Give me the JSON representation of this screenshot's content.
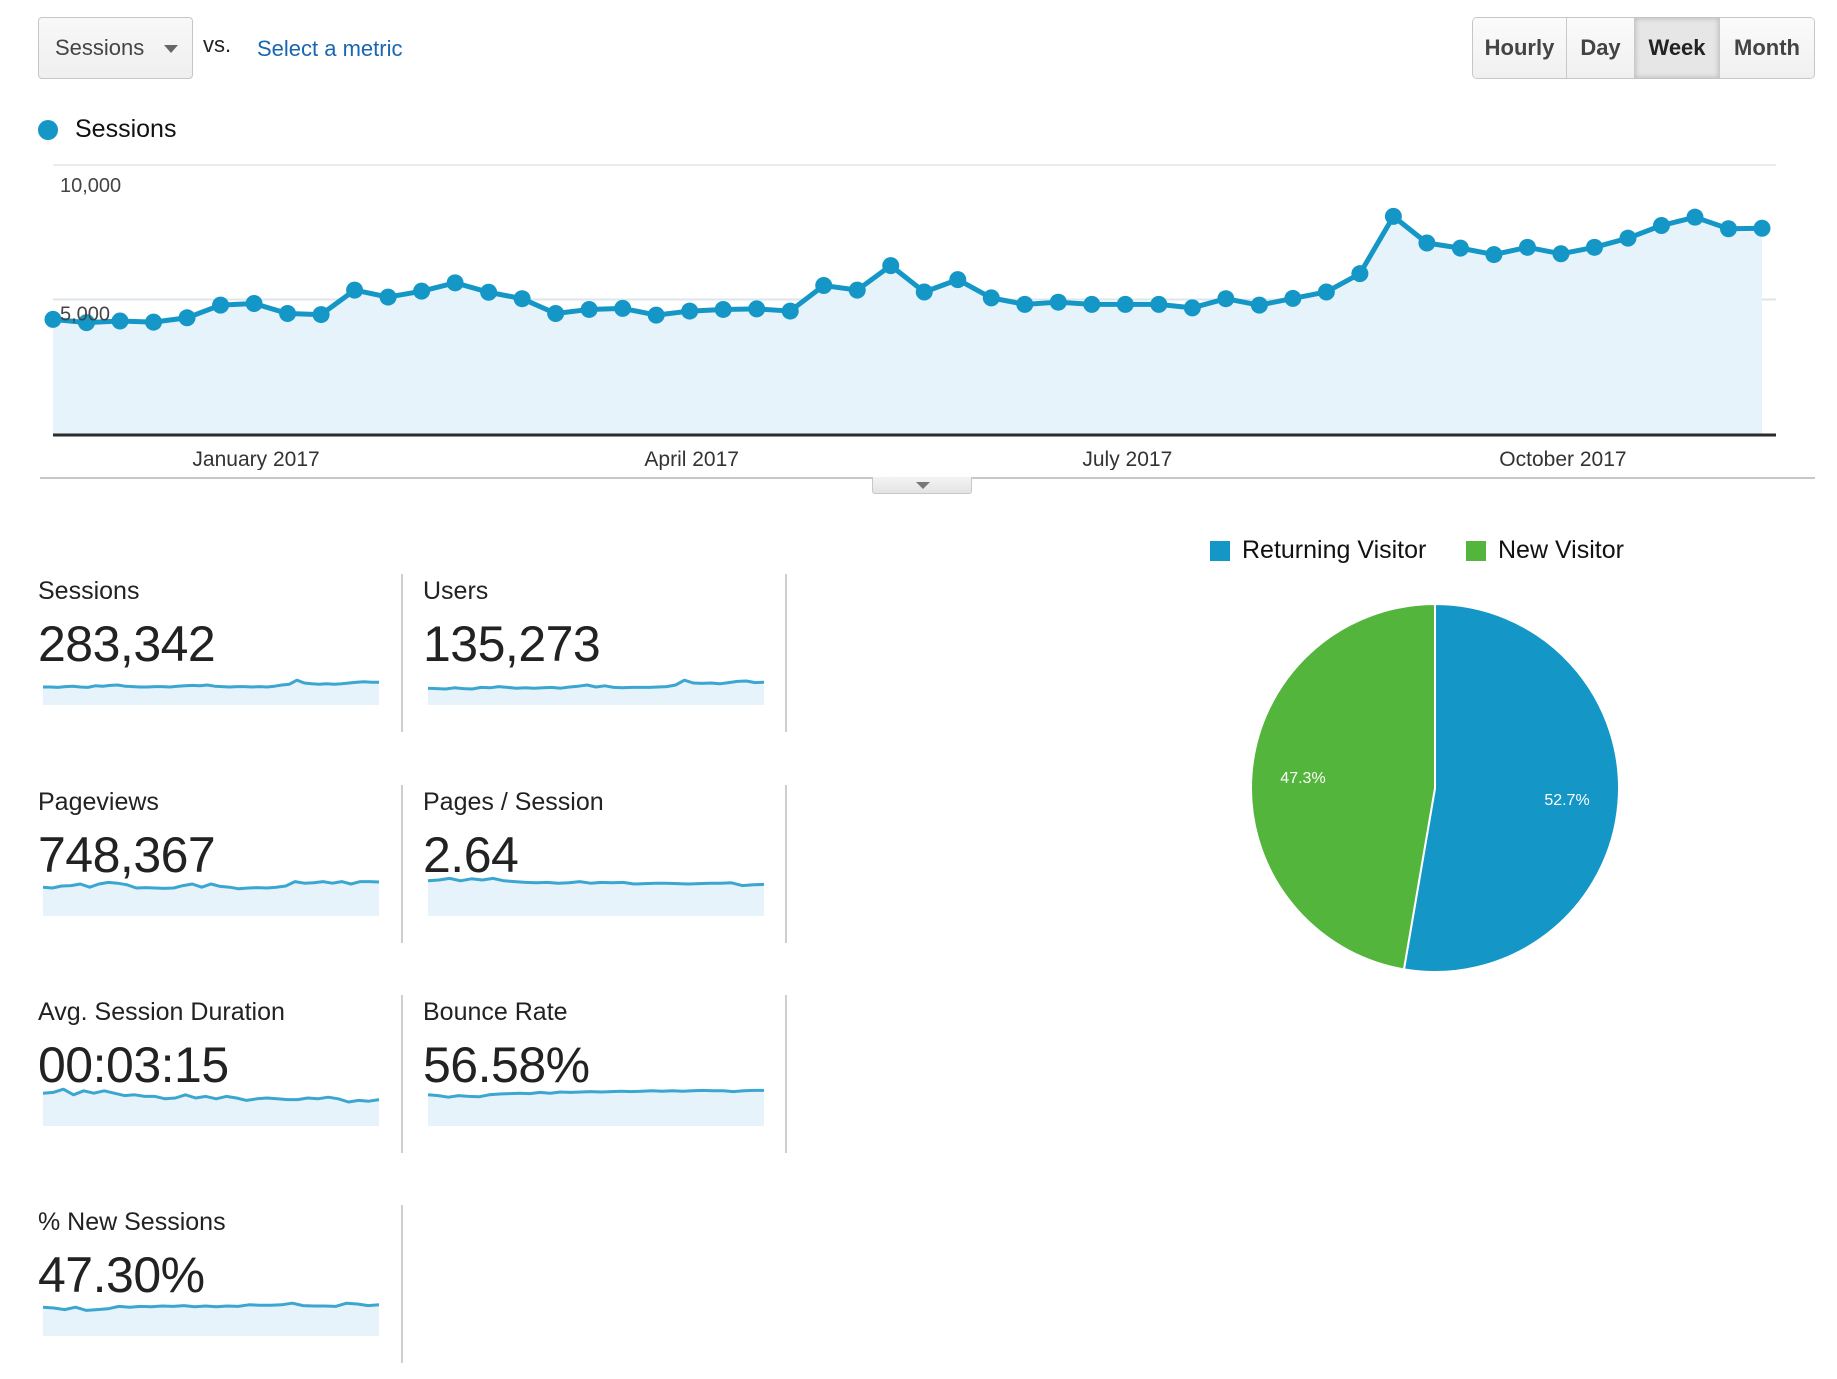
{
  "header": {
    "metric_select": {
      "selected": "Sessions"
    },
    "vs_label": "vs.",
    "select_metric_link": "Select a metric",
    "granularity": {
      "options": [
        "Hourly",
        "Day",
        "Week",
        "Month"
      ],
      "selected": "Week"
    }
  },
  "legend": {
    "label": "Sessions",
    "color": "#1497c6"
  },
  "colors": {
    "line": "#1497c6",
    "area": "#e6f3fa",
    "returning": "#1497c6",
    "new": "#53b53c",
    "sparkline": "#3ba6d0"
  },
  "chart_data": [
    {
      "type": "area",
      "title": "Sessions",
      "series": [
        {
          "name": "Sessions",
          "values": [
            4260,
            4140,
            4200,
            4160,
            4320,
            4790,
            4850,
            4480,
            4440,
            5350,
            5090,
            5310,
            5620,
            5270,
            5030,
            4480,
            4630,
            4670,
            4420,
            4570,
            4630,
            4650,
            4570,
            5520,
            5350,
            6260,
            5280,
            5740,
            5060,
            4820,
            4900,
            4820,
            4820,
            4820,
            4690,
            5030,
            4790,
            5040,
            5280,
            5960,
            8090,
            7100,
            6910,
            6670,
            6940,
            6700,
            6940,
            7280,
            7750,
            8060,
            7630,
            7650
          ]
        }
      ],
      "granularity": "week",
      "x_tick_labels": [
        "January 2017",
        "April 2017",
        "July 2017",
        "October 2017"
      ],
      "x_tick_indices": [
        6,
        19,
        32,
        45
      ],
      "y_ticks": [
        5000,
        10000
      ],
      "y_tick_labels": [
        "5,000",
        "10,000"
      ],
      "ylim": [
        0,
        10000
      ],
      "grid": true,
      "xlabel": "",
      "ylabel": ""
    },
    {
      "type": "pie",
      "title": "",
      "legend": [
        "Returning Visitor",
        "New Visitor"
      ],
      "legend_position": "top",
      "slices": [
        {
          "label": "Returning Visitor",
          "value": 52.7,
          "display": "52.7%"
        },
        {
          "label": "New Visitor",
          "value": 47.3,
          "display": "47.3%"
        }
      ]
    }
  ],
  "metrics": [
    {
      "label": "Sessions",
      "value": "283,342",
      "spark": [
        0.45,
        0.45,
        0.44,
        0.46,
        0.47,
        0.45,
        0.44,
        0.48,
        0.47,
        0.49,
        0.5,
        0.47,
        0.46,
        0.45,
        0.45,
        0.46,
        0.46,
        0.45,
        0.47,
        0.48,
        0.49,
        0.48,
        0.5,
        0.47,
        0.46,
        0.45,
        0.46,
        0.46,
        0.45,
        0.46,
        0.45,
        0.47,
        0.5,
        0.52,
        0.62,
        0.55,
        0.53,
        0.52,
        0.53,
        0.52,
        0.53,
        0.55,
        0.57,
        0.58,
        0.57,
        0.57
      ]
    },
    {
      "label": "Users",
      "value": "135,273",
      "spark": [
        0.42,
        0.41,
        0.4,
        0.43,
        0.41,
        0.4,
        0.44,
        0.43,
        0.46,
        0.44,
        0.42,
        0.43,
        0.42,
        0.43,
        0.44,
        0.42,
        0.45,
        0.47,
        0.5,
        0.45,
        0.48,
        0.44,
        0.43,
        0.44,
        0.44,
        0.44,
        0.45,
        0.46,
        0.5,
        0.62,
        0.55,
        0.54,
        0.55,
        0.53,
        0.56,
        0.59,
        0.6,
        0.56,
        0.57
      ]
    },
    {
      "label": "Pageviews",
      "value": "748,367",
      "spark": [
        0.72,
        0.7,
        0.75,
        0.76,
        0.8,
        0.72,
        0.8,
        0.84,
        0.82,
        0.78,
        0.7,
        0.71,
        0.7,
        0.69,
        0.7,
        0.76,
        0.8,
        0.72,
        0.8,
        0.74,
        0.72,
        0.68,
        0.7,
        0.71,
        0.7,
        0.72,
        0.75,
        0.86,
        0.82,
        0.83,
        0.86,
        0.82,
        0.86,
        0.8,
        0.86,
        0.86,
        0.85
      ]
    },
    {
      "label": "Pages / Session",
      "value": "2.64",
      "spark": [
        0.88,
        0.9,
        0.94,
        0.88,
        0.93,
        0.9,
        0.94,
        0.88,
        0.86,
        0.84,
        0.83,
        0.84,
        0.82,
        0.83,
        0.86,
        0.82,
        0.84,
        0.83,
        0.84,
        0.8,
        0.81,
        0.82,
        0.82,
        0.81,
        0.8,
        0.81,
        0.82,
        0.82,
        0.83,
        0.76,
        0.78,
        0.79
      ]
    },
    {
      "label": "Avg. Session Duration",
      "value": "00:03:15",
      "spark": [
        0.82,
        0.84,
        0.92,
        0.78,
        0.88,
        0.82,
        0.88,
        0.82,
        0.76,
        0.78,
        0.74,
        0.74,
        0.68,
        0.7,
        0.78,
        0.7,
        0.74,
        0.68,
        0.74,
        0.7,
        0.64,
        0.68,
        0.7,
        0.68,
        0.66,
        0.66,
        0.7,
        0.68,
        0.72,
        0.68,
        0.6,
        0.64,
        0.62,
        0.66
      ]
    },
    {
      "label": "Bounce Rate",
      "value": "56.58%",
      "spark": [
        0.78,
        0.76,
        0.72,
        0.76,
        0.74,
        0.73,
        0.78,
        0.8,
        0.81,
        0.82,
        0.81,
        0.84,
        0.82,
        0.85,
        0.84,
        0.85,
        0.86,
        0.85,
        0.86,
        0.87,
        0.86,
        0.87,
        0.88,
        0.87,
        0.88,
        0.87,
        0.88,
        0.89,
        0.88,
        0.88,
        0.86,
        0.88,
        0.89,
        0.89
      ]
    },
    {
      "label": "% New Sessions",
      "value": "47.30%",
      "spark": [
        0.72,
        0.7,
        0.66,
        0.72,
        0.64,
        0.66,
        0.68,
        0.74,
        0.72,
        0.74,
        0.73,
        0.75,
        0.74,
        0.76,
        0.73,
        0.75,
        0.73,
        0.75,
        0.74,
        0.78,
        0.77,
        0.77,
        0.78,
        0.82,
        0.76,
        0.75,
        0.75,
        0.74,
        0.82,
        0.8,
        0.76,
        0.78
      ]
    }
  ]
}
